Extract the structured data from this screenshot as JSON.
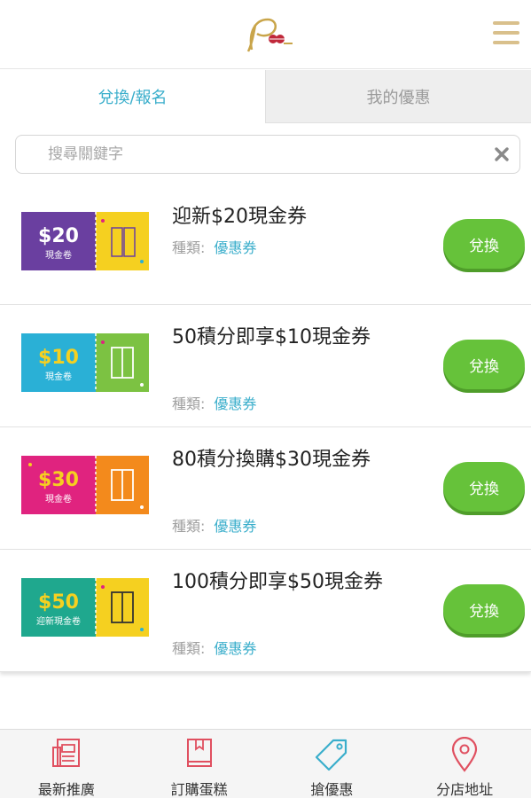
{
  "header": {
    "logo_text": "P",
    "menu_icon": "hamburger-menu-icon"
  },
  "tabs": [
    {
      "label": "兌換/報名",
      "active": true
    },
    {
      "label": "我的優惠",
      "active": false
    }
  ],
  "search": {
    "placeholder": "搜尋關鍵字",
    "value": "",
    "clear_icon": "close-icon"
  },
  "coupons": [
    {
      "title": "迎新$20現金券",
      "type_label": "種類:",
      "type_value": "優惠券",
      "button_label": "兌換",
      "coupon_amount": "$20",
      "coupon_caption": "現金卷",
      "left_color": "#6a3fa0",
      "right_color": "#f5d020"
    },
    {
      "title": "50積分即享$10現金券",
      "type_label": "種類:",
      "type_value": "優惠券",
      "button_label": "兌換",
      "coupon_amount": "$10",
      "coupon_caption": "現金卷",
      "left_color": "#2ab0d6",
      "right_color": "#7cc242"
    },
    {
      "title": "80積分換購$30現金券",
      "type_label": "種類:",
      "type_value": "優惠券",
      "button_label": "兌換",
      "coupon_amount": "$30",
      "coupon_caption": "現金卷",
      "left_color": "#e0237f",
      "right_color": "#f38a1c"
    },
    {
      "title": "100積分即享$50現金券",
      "type_label": "種類:",
      "type_value": "優惠券",
      "button_label": "兌換",
      "coupon_amount": "$50",
      "coupon_caption": "迎新現金卷",
      "left_color": "#1fa88e",
      "right_color": "#f5d020"
    }
  ],
  "bottom_nav": [
    {
      "label": "最新推廣",
      "icon": "newspaper-icon"
    },
    {
      "label": "訂購蛋糕",
      "icon": "book-icon"
    },
    {
      "label": "搶優惠",
      "icon": "price-tag-icon"
    },
    {
      "label": "分店地址",
      "icon": "map-pin-icon"
    }
  ],
  "colors": {
    "accent": "#3aaecb",
    "button_green": "#66c23a",
    "nav_icon": "#e05060",
    "menu_gold": "#d9c08c"
  }
}
